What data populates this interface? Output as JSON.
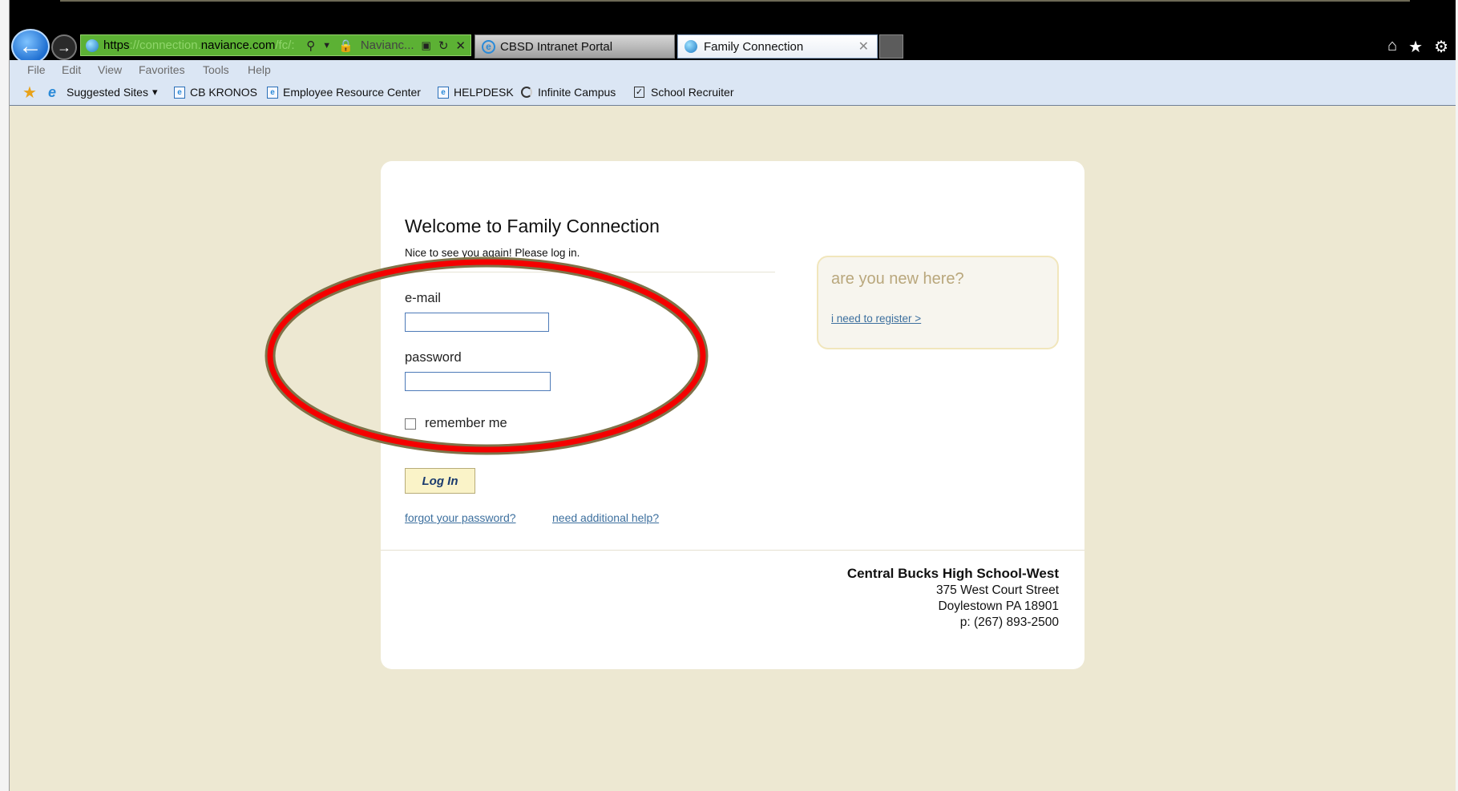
{
  "browser": {
    "address": {
      "prefix": "https",
      "dim1": "://connection.",
      "host": "naviance.com",
      "dim2": "/fc/:",
      "site_label": "Navianc..."
    },
    "tabs": [
      {
        "label": "CBSD Intranet Portal"
      },
      {
        "label": "Family Connection",
        "close": "✕"
      }
    ],
    "menu": [
      "File",
      "Edit",
      "View",
      "Favorites",
      "Tools",
      "Help"
    ],
    "favorites": [
      {
        "label": "Suggested Sites",
        "dropdown": "▾"
      },
      {
        "label": "CB KRONOS"
      },
      {
        "label": "Employee Resource Center"
      },
      {
        "label": "HELPDESK"
      },
      {
        "label": "Infinite Campus"
      },
      {
        "label": "School Recruiter"
      }
    ]
  },
  "login": {
    "title": "Welcome to Family Connection",
    "subtitle": "Nice to see you again! Please log in.",
    "email_label": "e-mail",
    "email_value": "",
    "password_label": "password",
    "password_value": "",
    "remember_label": "remember me",
    "remember_checked": false,
    "login_button": "Log In",
    "forgot_link": "forgot your password?",
    "help_link": "need additional help?"
  },
  "new_user": {
    "title": "are you new here?",
    "register_link": "i need to register >"
  },
  "school": {
    "name": "Central Bucks High School-West",
    "street": "375 West Court Street",
    "city": "Doylestown PA 18901",
    "phone": "p: (267) 893-2500"
  },
  "annotation": {
    "outer_color": "#7e7349",
    "inner_color": "#f40000"
  }
}
